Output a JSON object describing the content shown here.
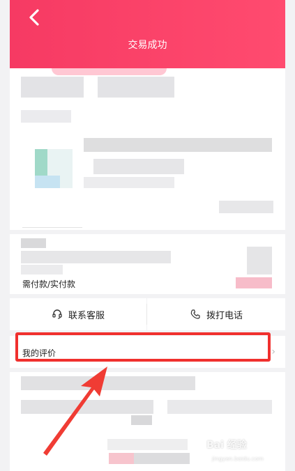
{
  "header": {
    "title": "交易成功"
  },
  "payment": {
    "label": "需付款/实付款"
  },
  "actions": {
    "contact_service": "联系客服",
    "call_phone": "拨打电话"
  },
  "review": {
    "label": "我的评价"
  },
  "watermark": {
    "brand": "Bai 经验",
    "url": "jingyan.baidu.com"
  },
  "colors": {
    "header_accent": "#f63a63",
    "highlight_box": "#f0302e",
    "arrow": "#f03c34"
  },
  "icons": {
    "back": "chevron-left-icon",
    "headset": "headset-icon",
    "phone": "phone-icon",
    "chevron": "chevron-right-icon"
  }
}
